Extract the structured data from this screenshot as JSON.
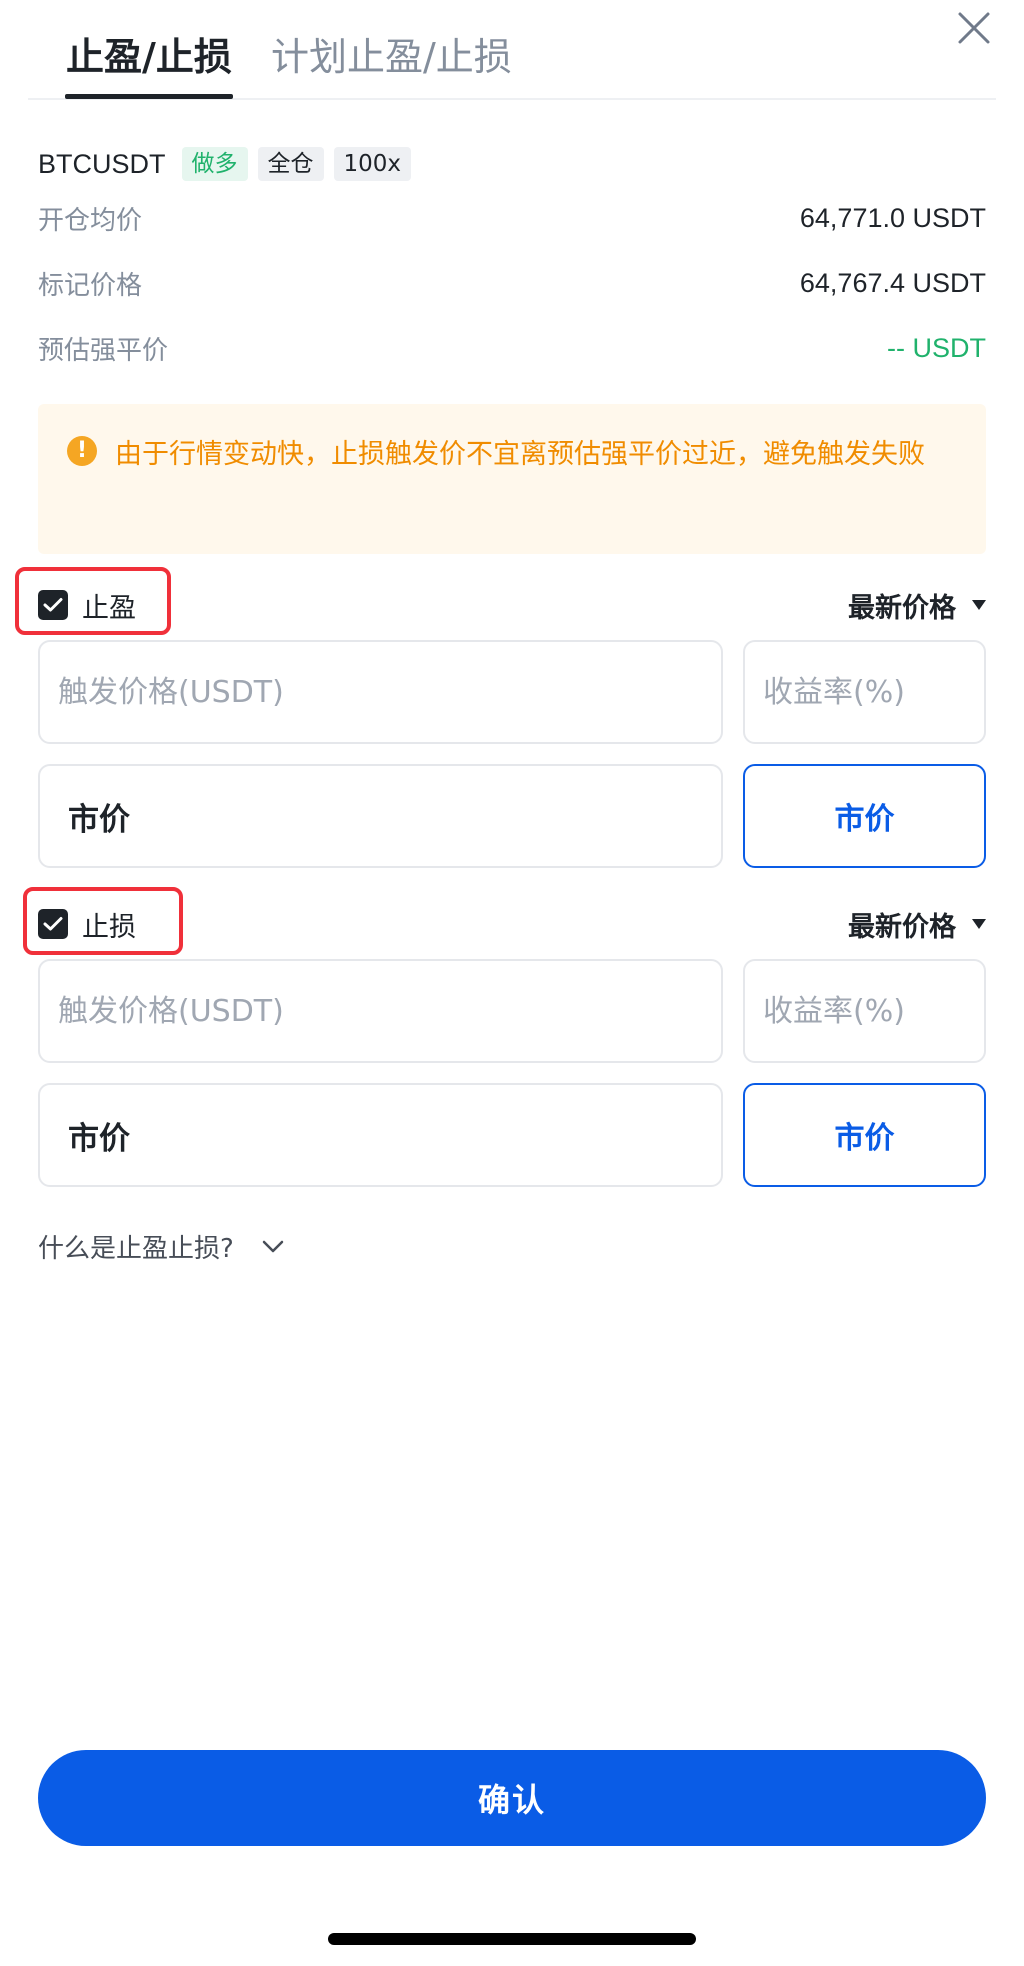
{
  "tabs": [
    {
      "label": "止盈/止损"
    },
    {
      "label": "计划止盈/止损"
    }
  ],
  "icons": {
    "close": "close-icon",
    "warning": "exclamation-icon",
    "check": "check-icon",
    "dropdown": "triangle-down-icon",
    "chevron": "chevron-down-icon"
  },
  "position": {
    "symbol": "BTCUSDT",
    "side": "做多",
    "margin_mode": "全仓",
    "leverage": "100x"
  },
  "info": [
    {
      "label": "开仓均价",
      "value": "64,771.0 USDT"
    },
    {
      "label": "标记价格",
      "value": "64,767.4 USDT"
    },
    {
      "label": "预估强平价",
      "value": "-- USDT"
    }
  ],
  "warning": {
    "text": "由于行情变动快，止损触发价不宜离预估强平价过近，避免触发失败"
  },
  "take_profit": {
    "label": "止盈",
    "checked": true,
    "price_type": "最新价格",
    "trigger_placeholder": "触发价格(USDT)",
    "roe_placeholder": "收益率(%)",
    "order_price": "市价",
    "market_button": "市价"
  },
  "stop_loss": {
    "label": "止损",
    "checked": true,
    "price_type": "最新价格",
    "trigger_placeholder": "触发价格(USDT)",
    "roe_placeholder": "收益率(%)",
    "order_price": "市价",
    "market_button": "市价"
  },
  "faq": {
    "label": "什么是止盈止损?"
  },
  "confirm": {
    "label": "确认"
  },
  "colors": {
    "accent": "#0a5ce6",
    "long": "#20b26c",
    "warning": "#f08c00",
    "highlight": "#f0303a"
  }
}
